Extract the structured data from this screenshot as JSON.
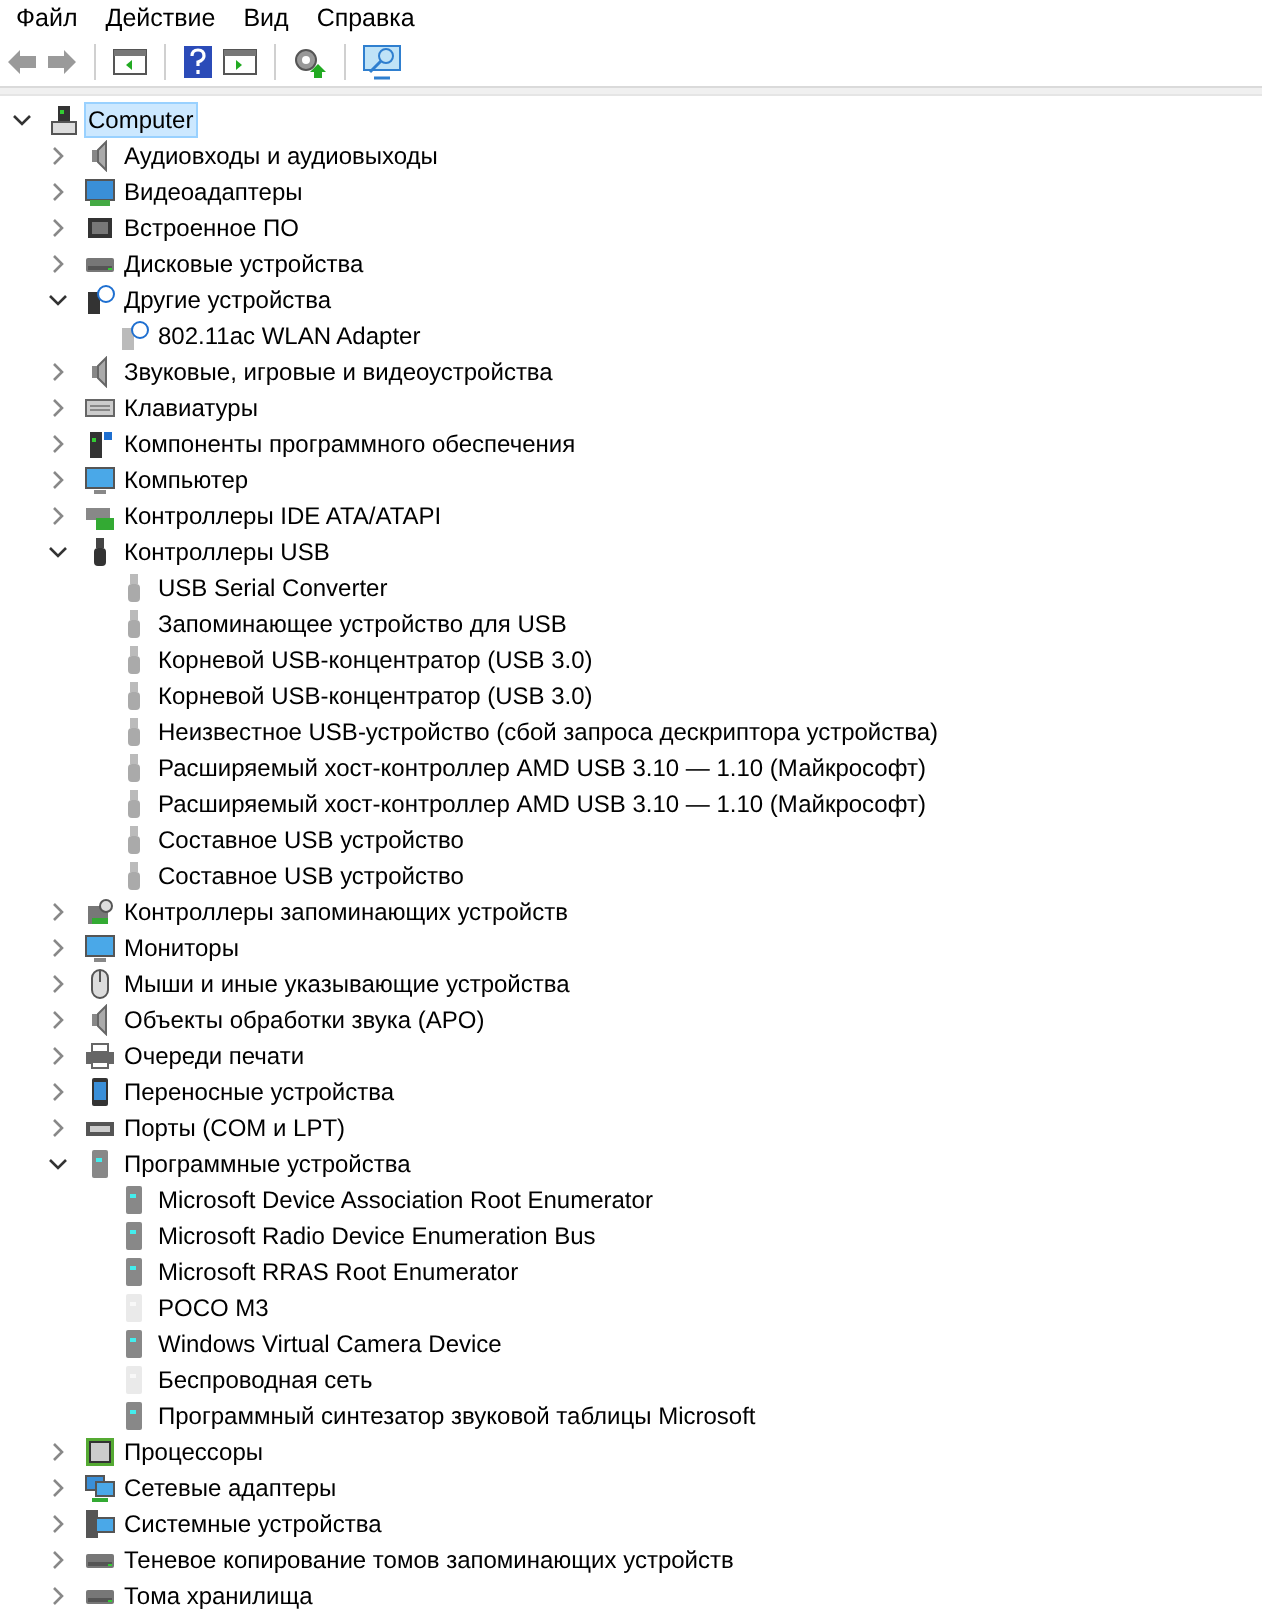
{
  "menu": [
    "Файл",
    "Действие",
    "Вид",
    "Справка"
  ],
  "toolbar": [
    {
      "kind": "back",
      "disabled": true
    },
    {
      "kind": "forward",
      "disabled": true
    },
    {
      "kind": "sep"
    },
    {
      "kind": "console"
    },
    {
      "kind": "sep"
    },
    {
      "kind": "help"
    },
    {
      "kind": "pane"
    },
    {
      "kind": "sep"
    },
    {
      "kind": "update"
    },
    {
      "kind": "sep"
    },
    {
      "kind": "scan"
    }
  ],
  "tree": {
    "label": "Computer",
    "kind": "computer",
    "expanded": true,
    "selected": true,
    "children": [
      {
        "label": "Аудиовходы и аудиовыходы",
        "kind": "speaker",
        "expanded": false
      },
      {
        "label": "Видеоадаптеры",
        "kind": "display",
        "expanded": false
      },
      {
        "label": "Встроенное ПО",
        "kind": "firmware",
        "expanded": false
      },
      {
        "label": "Дисковые устройства",
        "kind": "disk",
        "expanded": false
      },
      {
        "label": "Другие устройства",
        "kind": "unknown",
        "expanded": true,
        "children": [
          {
            "label": "802.11ac WLAN Adapter",
            "kind": "unknown-device"
          }
        ]
      },
      {
        "label": "Звуковые, игровые и видеоустройства",
        "kind": "speaker",
        "expanded": false
      },
      {
        "label": "Клавиатуры",
        "kind": "keyboard",
        "expanded": false
      },
      {
        "label": "Компоненты программного обеспечения",
        "kind": "component",
        "expanded": false
      },
      {
        "label": "Компьютер",
        "kind": "monitor",
        "expanded": false
      },
      {
        "label": "Контроллеры IDE ATA/ATAPI",
        "kind": "ide",
        "expanded": false
      },
      {
        "label": "Контроллеры USB",
        "kind": "usb",
        "expanded": true,
        "children": [
          {
            "label": "USB Serial Converter",
            "kind": "usb-device"
          },
          {
            "label": "Запоминающее устройство для USB",
            "kind": "usb-device"
          },
          {
            "label": "Корневой USB-концентратор (USB 3.0)",
            "kind": "usb-device"
          },
          {
            "label": "Корневой USB-концентратор (USB 3.0)",
            "kind": "usb-device"
          },
          {
            "label": "Неизвестное USB-устройство (сбой запроса дескриптора устройства)",
            "kind": "usb-device"
          },
          {
            "label": "Расширяемый хост-контроллер AMD USB 3.10 — 1.10 (Майкрософт)",
            "kind": "usb-device"
          },
          {
            "label": "Расширяемый хост-контроллер AMD USB 3.10 — 1.10 (Майкрософт)",
            "kind": "usb-device"
          },
          {
            "label": "Составное USB устройство",
            "kind": "usb-device"
          },
          {
            "label": "Составное USB устройство",
            "kind": "usb-device"
          }
        ]
      },
      {
        "label": "Контроллеры запоминающих устройств",
        "kind": "storage",
        "expanded": false
      },
      {
        "label": "Мониторы",
        "kind": "monitor",
        "expanded": false
      },
      {
        "label": "Мыши и иные указывающие устройства",
        "kind": "mouse",
        "expanded": false
      },
      {
        "label": "Объекты обработки звука (APO)",
        "kind": "speaker",
        "expanded": false
      },
      {
        "label": "Очереди печати",
        "kind": "printer",
        "expanded": false
      },
      {
        "label": "Переносные устройства",
        "kind": "portable",
        "expanded": false
      },
      {
        "label": "Порты (COM и LPT)",
        "kind": "port",
        "expanded": false
      },
      {
        "label": "Программные устройства",
        "kind": "software",
        "expanded": true,
        "children": [
          {
            "label": "Microsoft Device Association Root Enumerator",
            "kind": "software-device",
            "hidden": false
          },
          {
            "label": "Microsoft Radio Device Enumeration Bus",
            "kind": "software-device",
            "hidden": false
          },
          {
            "label": "Microsoft RRAS Root Enumerator",
            "kind": "software-device",
            "hidden": false
          },
          {
            "label": "POCO M3",
            "kind": "software-device",
            "hidden": true
          },
          {
            "label": "Windows Virtual Camera Device",
            "kind": "software-device",
            "hidden": false
          },
          {
            "label": "Беспроводная сеть",
            "kind": "software-device",
            "hidden": true
          },
          {
            "label": "Программный синтезатор звуковой таблицы Microsoft",
            "kind": "software-device",
            "hidden": false
          }
        ]
      },
      {
        "label": "Процессоры",
        "kind": "cpu",
        "expanded": false
      },
      {
        "label": "Сетевые адаптеры",
        "kind": "network",
        "expanded": false
      },
      {
        "label": "Системные устройства",
        "kind": "system",
        "expanded": false
      },
      {
        "label": "Теневое копирование томов запоминающих устройств",
        "kind": "drive",
        "expanded": false
      },
      {
        "label": "Тома хранилища",
        "kind": "drive",
        "expanded": false
      }
    ]
  }
}
